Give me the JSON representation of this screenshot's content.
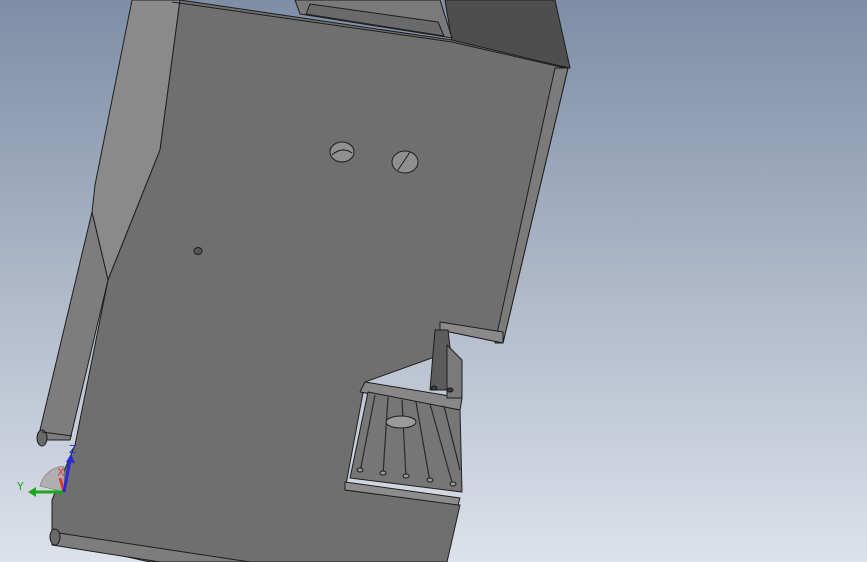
{
  "viewport": {
    "background_top": "#7d8ea6",
    "background_bottom": "#dde1ea"
  },
  "model": {
    "face_color": "#6f6f6f",
    "side_color": "#8a8a8a",
    "dark_color": "#4e4e4e",
    "edge_color": "#1e1e1e"
  },
  "triad": {
    "x_label": "X",
    "y_label": "Y",
    "z_label": "Z",
    "x_color": "#d83a3a",
    "y_color": "#1fa51f",
    "z_color": "#2a2ad6"
  }
}
